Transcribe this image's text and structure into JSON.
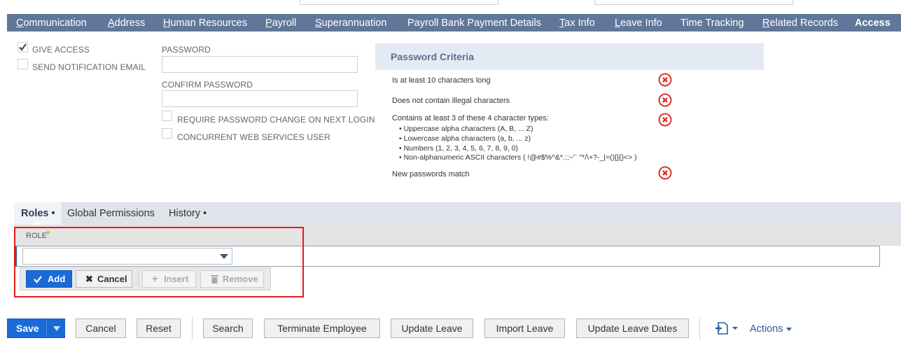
{
  "tabs": [
    {
      "label": "Communication",
      "ul": "C",
      "rest": "ommunication",
      "active": false
    },
    {
      "label": "Address",
      "ul": "A",
      "rest": "ddress",
      "active": false
    },
    {
      "label": "Human Resources",
      "ul": "H",
      "rest": "uman Resources",
      "active": false
    },
    {
      "label": "Payroll",
      "ul": "P",
      "rest": "ayroll",
      "active": false
    },
    {
      "label": "Superannuation",
      "ul": "S",
      "rest": "uperannuation",
      "active": false
    },
    {
      "label": "Payroll Bank Payment Details",
      "ul": "",
      "rest": "Payroll Bank Payment Details",
      "active": false
    },
    {
      "label": "Tax Info",
      "ul": "T",
      "rest": "ax Info",
      "active": false
    },
    {
      "label": "Leave Info",
      "ul": "L",
      "rest": "eave Info",
      "active": false
    },
    {
      "label": "Time Tracking",
      "ul": "",
      "rest": "Time Tracking",
      "active": false
    },
    {
      "label": "Related Records",
      "ul": "R",
      "rest": "elated Records",
      "active": false
    },
    {
      "label": "Access",
      "ul": "",
      "rest": "Access",
      "active": true
    }
  ],
  "access": {
    "give_access": {
      "label": "GIVE ACCESS",
      "checked": true
    },
    "send_notification": {
      "label": "SEND NOTIFICATION EMAIL",
      "checked": false
    },
    "password_label": "PASSWORD",
    "confirm_label": "CONFIRM PASSWORD",
    "require_change": {
      "label": "REQUIRE PASSWORD CHANGE ON NEXT LOGIN",
      "checked": false
    },
    "concurrent_ws": {
      "label": "CONCURRENT WEB SERVICES USER",
      "checked": false
    }
  },
  "criteria": {
    "title": "Password Criteria",
    "items": [
      "Is at least 10 characters long",
      "Does not contain illegal characters",
      "Contains at least 3 of these 4 character types:",
      "New passwords match"
    ],
    "bullets": [
      "• Uppercase alpha characters (A, B, ... Z)",
      "• Lowercase alpha characters (a, b, ... z)",
      "• Numbers (1, 2, 3, 4, 5, 6, 7, 8, 9, 0)",
      "• Non-alphanumeric ASCII characters ( !@#$%^&*.:;~'` \"*/\\+?-_|=()[]{}<> )"
    ],
    "status_icon": "error-x-icon",
    "error_color": "#d9352a"
  },
  "sublist": {
    "tabs": [
      "Roles •",
      "Global Permissions",
      "History •"
    ],
    "column_label": "ROLE",
    "required_mark": "*",
    "buttons": {
      "add": "Add",
      "cancel": "Cancel",
      "insert": "Insert",
      "remove": "Remove"
    }
  },
  "footer": {
    "save": "Save",
    "buttons": [
      "Cancel",
      "Reset",
      "Search",
      "Terminate Employee",
      "Update Leave",
      "Import Leave",
      "Update Leave Dates"
    ],
    "actions": "Actions"
  },
  "colors": {
    "tabbar": "#607799",
    "primary": "#1a6ad8",
    "highlight": "#e31b1b"
  }
}
